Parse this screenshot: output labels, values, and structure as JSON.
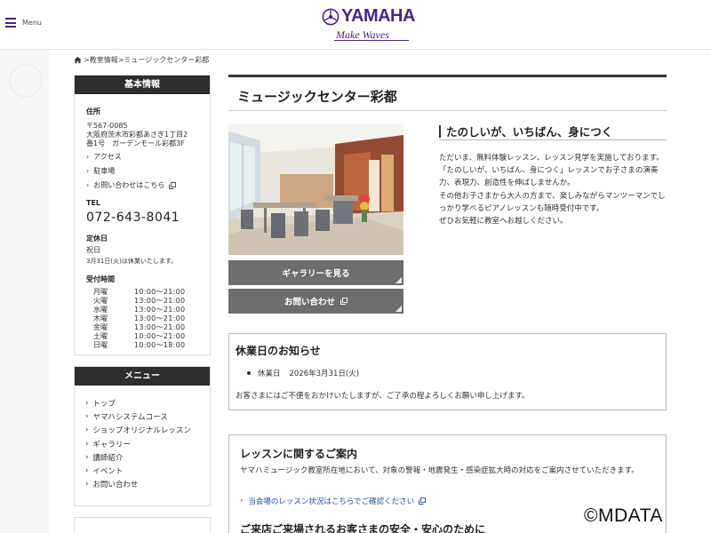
{
  "header": {
    "menu_label": "Menu",
    "brand": "YAMAHA",
    "tagline": "Make Waves"
  },
  "breadcrumb": {
    "home_icon": "home-icon",
    "items": [
      "教室情報",
      "ミュージックセンター彩都"
    ],
    "separator": ">"
  },
  "sidebar": {
    "info_heading": "基本情報",
    "address_label": "住所",
    "postal": "〒567-0085",
    "address_line1": "大阪府茨木市彩都あさぎ1丁目2",
    "address_line2": "番1号　ガーデンモール彩都3F",
    "links": [
      {
        "label": "アクセス",
        "external": false
      },
      {
        "label": "駐車場",
        "external": false
      },
      {
        "label": "お問い合わせはこちら",
        "external": true
      }
    ],
    "tel_label": "TEL",
    "tel": "072-643-8041",
    "closed_label": "定休日",
    "closed_value": "祝日",
    "closed_note": "3月31日(火)は休業いたします。",
    "hours_label": "受付時間",
    "hours": [
      {
        "day": "月曜",
        "time": "10:00～21:00"
      },
      {
        "day": "火曜",
        "time": "13:00～21:00"
      },
      {
        "day": "水曜",
        "time": "13:00～21:00"
      },
      {
        "day": "木曜",
        "time": "13:00～21:00"
      },
      {
        "day": "金曜",
        "time": "13:00～21:00"
      },
      {
        "day": "土曜",
        "time": "10:00～21:00"
      },
      {
        "day": "日曜",
        "time": "10:00～18:00"
      }
    ],
    "menu_heading": "メニュー",
    "menu_items": [
      "トップ",
      "ヤマハシステムコース",
      "ショップオリジナルレッスン",
      "ギャラリー",
      "講師紹介",
      "イベント",
      "お問い合わせ"
    ]
  },
  "main": {
    "title": "ミュージックセンター彩都",
    "gallery_button": "ギャラリーを見る",
    "inquiry_button": "お問い合わせ",
    "catch": "たのしいが、いちばん、身につく",
    "intro": [
      "ただいま、無料体験レッスン、レッスン見学を実施しております。",
      "「たのしいが、いちばん、身につく」レッスンでお子さまの演奏力、表現力、創造性を伸ばしませんか。",
      "その他お子さまから大人の方まで、楽しみながらマンツーマンでしっかり学べるピアノレッスンも随時受付中です。",
      "ぜひお気軽に教室へお越しください。"
    ],
    "notice": {
      "title": "休業日のお知らせ",
      "item_label": "休業日",
      "item_date": "2026年3月31日(火)",
      "text": "お客さまにはご不便をおかけいたしますが、ご了承の程よろしくお願い申し上げます。"
    },
    "lesson": {
      "title": "レッスンに関するご案内",
      "text": "ヤマハミュージック教室所在地において、対象の警報・地震発生・感染症拡大時の対応をご案内させていただきます。",
      "link": "当会場のレッスン状況はこちらでご確認ください",
      "title2": "ご来店ご来場されるお客さまの安全・安心のために"
    }
  },
  "watermark": "©MDATA"
}
